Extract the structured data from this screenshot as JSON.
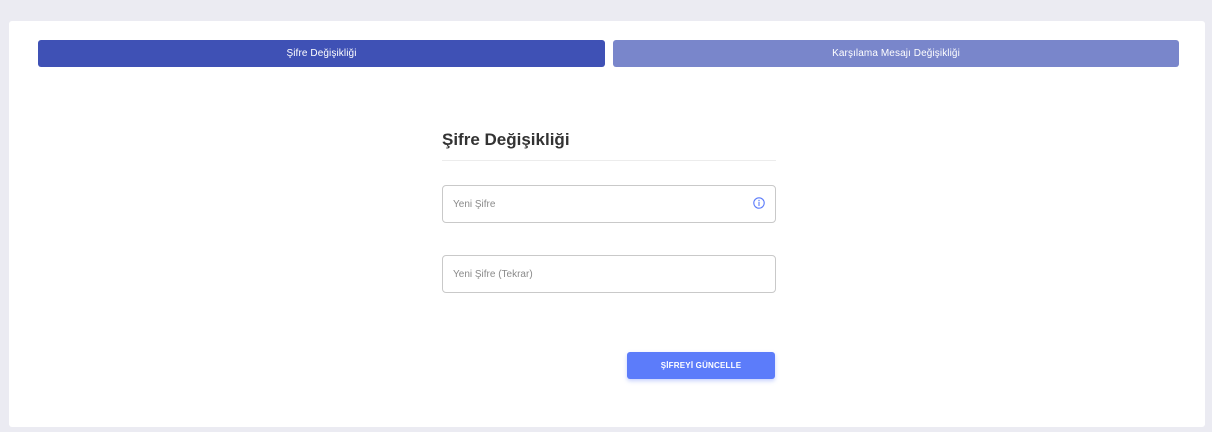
{
  "tabs": [
    {
      "label": "Şifre Değişikliği",
      "active": true
    },
    {
      "label": "Karşılama Mesajı Değişikliği",
      "active": false
    }
  ],
  "form": {
    "title": "Şifre Değişikliği",
    "new_password": {
      "placeholder": "Yeni Şifre",
      "value": "",
      "icon": "info-icon"
    },
    "confirm_password": {
      "placeholder": "Yeni Şifre (Tekrar)",
      "value": ""
    },
    "submit_label": "ŞİFREYİ GÜNCELLE"
  },
  "colors": {
    "tab_active": "#3f51b5",
    "tab_inactive": "#7986cb",
    "button": "#5c7cfa",
    "page_background": "#ebebf2"
  }
}
